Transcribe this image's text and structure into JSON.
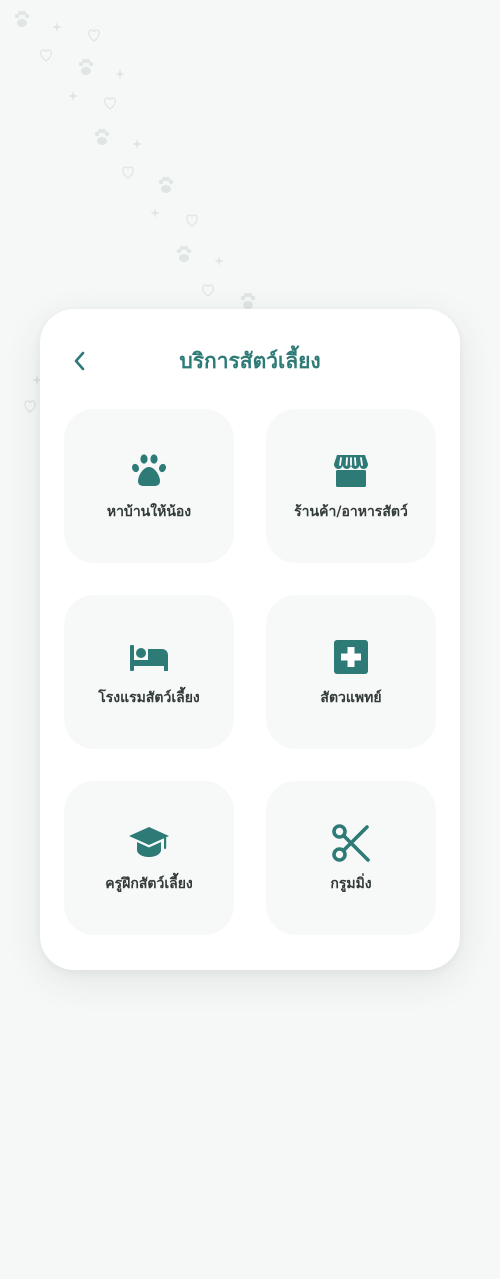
{
  "header": {
    "title": "บริการสัตว์เลี้ยง",
    "back_icon": "chevron-left-icon"
  },
  "services": [
    {
      "label": "หาบ้านให้น้อง",
      "icon": "paw-icon"
    },
    {
      "label": "ร้านค้า/อาหารสัตว์",
      "icon": "store-icon"
    },
    {
      "label": "โรงแรมสัตว์เลี้ยง",
      "icon": "bed-icon"
    },
    {
      "label": "สัตวแพทย์",
      "icon": "medical-cross-icon"
    },
    {
      "label": "ครูฝึกสัตว์เลี้ยง",
      "icon": "graduation-cap-icon"
    },
    {
      "label": "กรูมมิ่ง",
      "icon": "scissors-icon"
    }
  ],
  "colors": {
    "accent": "#2e7a76",
    "background": "#f6f8f7",
    "card": "#ffffff",
    "tile": "#f7f9f8",
    "label_text": "#333b3a"
  }
}
